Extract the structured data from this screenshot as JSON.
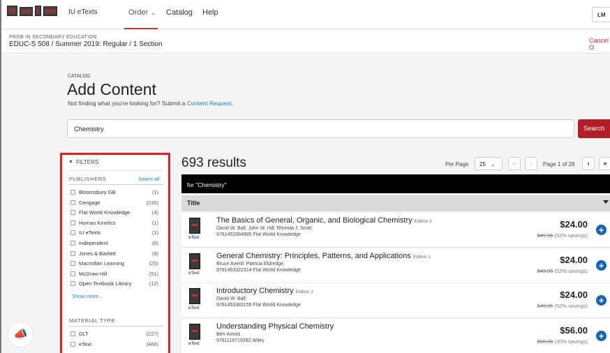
{
  "header": {
    "brand": "IU eTexts",
    "nav": {
      "order": "Order",
      "catalog": "Catalog",
      "help": "Help"
    },
    "user_initials": "LM"
  },
  "course": {
    "subtitle": "PROB IN SECONDARY EDUCATION",
    "title": "EDUC-S 508 / Summer 2019: Regular / 1 Section",
    "cancel": "Cancel O"
  },
  "catalog": {
    "kicker": "CATALOG",
    "title": "Add Content",
    "note_prefix": "Not finding what you're looking for? Submit a ",
    "note_link": "Content Request",
    "note_suffix": "."
  },
  "search": {
    "value": "Chemistry",
    "button": "Search"
  },
  "filters": {
    "heading": "FILTERS",
    "publishers_label": "PUBLISHERS",
    "select_all": "Select all",
    "publishers": [
      {
        "name": "Bloomsbury GB",
        "count": "(1)"
      },
      {
        "name": "Cengage",
        "count": "(235)"
      },
      {
        "name": "Flat World Knowledge",
        "count": "(4)"
      },
      {
        "name": "Human Kinetics",
        "count": "(1)"
      },
      {
        "name": "IU eTexts",
        "count": "(1)"
      },
      {
        "name": "Independent",
        "count": "(6)"
      },
      {
        "name": "Jones & Bartlett",
        "count": "(8)"
      },
      {
        "name": "Macmillan Learning",
        "count": "(25)"
      },
      {
        "name": "McGraw Hill",
        "count": "(51)"
      },
      {
        "name": "Open Textbook Library",
        "count": "(12)"
      }
    ],
    "show_more": "Show more...",
    "material_label": "MATERIAL TYPE",
    "materials": [
      {
        "name": "DLT",
        "count": "(227)"
      },
      {
        "name": "eText",
        "count": "(466)"
      }
    ]
  },
  "results": {
    "count": "693 results",
    "per_page_label": "Per Page",
    "per_page": "25",
    "page_label": "Page 1 of 28",
    "first": "«",
    "prev": "‹",
    "next": "›",
    "last": "»",
    "for_text": "for \"Chemistry\"",
    "title_col": "Title",
    "items": [
      {
        "title": "The Basics of General, Organic, and Biological Chemistry",
        "edition": "Edition 2",
        "authors": "David W. Ball; John W. Hill; Rhonda J. Scott;",
        "isbn_pub": "9781453384985 Flat World Knowledge",
        "type": "eText",
        "price": "$24.00",
        "orig": "$49.95",
        "savings": "(52% savings)"
      },
      {
        "title": "General Chemistry: Principles, Patterns, and Applications",
        "edition": "Edition 1",
        "authors": "Bruce Averill; Patricia Eldredge;",
        "isbn_pub": "9781453322314 Flat World Knowledge",
        "type": "eText",
        "price": "$24.00",
        "orig": "$49.95",
        "savings": "(52% savings)"
      },
      {
        "title": "Introductory Chemistry",
        "edition": "Edition 2",
        "authors": "David W. Ball;",
        "isbn_pub": "9781453383155 Flat World Knowledge",
        "type": "eText",
        "price": "$24.00",
        "orig": "$49.95",
        "savings": "(52% savings)"
      },
      {
        "title": "Understanding Physical Chemistry",
        "edition": "",
        "authors": "Ben-Amotz",
        "isbn_pub": "9781118719282 Wiley",
        "type": "eText",
        "price": "$56.00",
        "orig": "$80.00",
        "savings": "(30% savings)"
      }
    ]
  },
  "colors": {
    "accent": "#b11e26",
    "link": "#1a7bc8",
    "highlight_box": "#e02020",
    "add_button": "#1565b0"
  }
}
